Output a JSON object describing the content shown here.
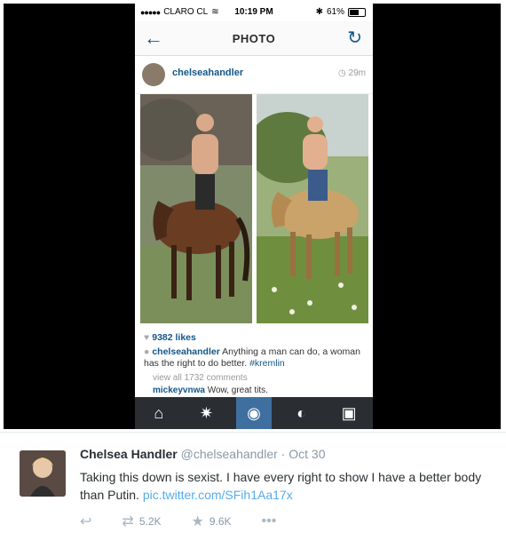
{
  "statusbar": {
    "carrier": "CLARO CL",
    "time": "10:19 PM",
    "battery": "61%"
  },
  "navbar": {
    "title": "PHOTO"
  },
  "post": {
    "username": "chelseahandler",
    "age": "29m",
    "likes": "9382 likes",
    "caption_user": "chelseahandler",
    "caption_text": "Anything a man can do, a woman has the right to do better.",
    "caption_tag": "#kremlin",
    "view_all": "view all 1732 comments",
    "comment_user": "mickeyvnwa",
    "comment_text": "Wow, great tits."
  },
  "tweet": {
    "name": "Chelsea Handler",
    "handle": "@chelseahandler",
    "date": "Oct 30",
    "text": "Taking this down is sexist. I have every right to show I have a better body than Putin.",
    "link": "pic.twitter.com/SFih1Aa17x",
    "retweets": "5.2K",
    "favorites": "9.6K"
  },
  "icons": {
    "back": "arrow-left-icon",
    "refresh": "refresh-icon",
    "home": "home-icon",
    "explore": "explore-icon",
    "camera": "camera-icon",
    "activity": "activity-icon",
    "profile": "profile-icon"
  }
}
